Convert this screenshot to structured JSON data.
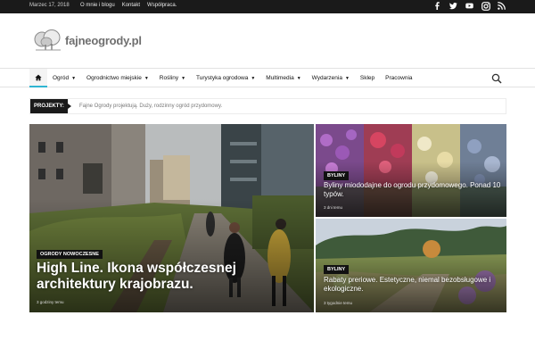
{
  "topbar": {
    "date": "Marzec 17, 2018",
    "links": [
      "O mnie i blogu",
      "Kontakt",
      "Współpraca."
    ],
    "social": [
      "facebook-icon",
      "twitter-icon",
      "youtube-icon",
      "instagram-icon",
      "rss-icon"
    ]
  },
  "logo": {
    "text": "fajneogrody.pl"
  },
  "nav": {
    "items": [
      {
        "label": "Ogród",
        "dropdown": true
      },
      {
        "label": "Ogrodnictwo miejskie",
        "dropdown": true
      },
      {
        "label": "Rośliny",
        "dropdown": true
      },
      {
        "label": "Turystyka ogrodowa",
        "dropdown": true
      },
      {
        "label": "Multimedia",
        "dropdown": true
      },
      {
        "label": "Wydarzenia",
        "dropdown": true
      },
      {
        "label": "Sklep",
        "dropdown": false
      },
      {
        "label": "Pracownia",
        "dropdown": false
      }
    ],
    "accent": "#2fb5d2"
  },
  "ticker": {
    "label": "PROJEKTY:",
    "text": "Fajne Ogrody projektują. Duży, rodzinny ogród przydomowy."
  },
  "featured": {
    "main": {
      "category": "OGRODY NOWOCZESNE",
      "title": "High Line. Ikona współczesnej architektury krajobrazu.",
      "time": "3 godziny temu"
    },
    "right_top": {
      "category": "BYLINY",
      "title": "Byliny miododajne do ogrodu przydomowego. Ponad 10 typów.",
      "time": "3 dni temu"
    },
    "right_bottom": {
      "category": "BYLINY",
      "title": "Rabaty preriowe. Estetyczne, niemal bezobsługowe i ekologiczne.",
      "time": "3 tygodnie temu"
    }
  }
}
